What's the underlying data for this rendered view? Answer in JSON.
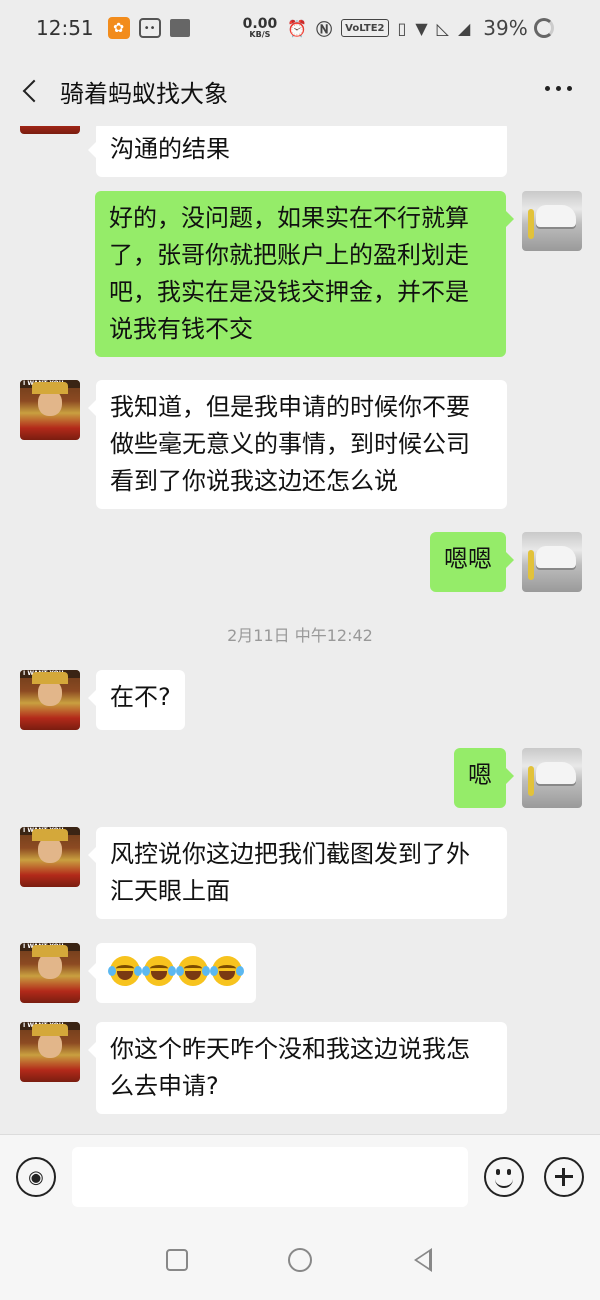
{
  "status_bar": {
    "time": "12:51",
    "net_speed_value": "0.00",
    "net_speed_unit": "KB/S",
    "volte": "VoLTE2",
    "battery": "39%"
  },
  "header": {
    "title": "骑着蚂蚁找大象"
  },
  "messages": [
    {
      "side": "in",
      "text": "沟通的结果"
    },
    {
      "side": "out",
      "text": "好的，没问题，如果实在不行就算了，张哥你就把账户上的盈利划走吧，我实在是没钱交押金，并不是说我有钱不交"
    },
    {
      "side": "in",
      "text": "我知道，但是我申请的时候你不要做些毫无意义的事情，到时候公司看到了你说我这边还怎么说"
    },
    {
      "side": "out",
      "text": "嗯嗯"
    },
    {
      "side": "in",
      "text": "在不?"
    },
    {
      "side": "out",
      "text": "嗯"
    },
    {
      "side": "in",
      "text": "风控说你这边把我们截图发到了外汇天眼上面"
    },
    {
      "side": "in",
      "text": "",
      "emoji": "laugh-cry x4"
    },
    {
      "side": "in",
      "text": "你这个昨天咋个没和我这边说我怎么去申请?"
    }
  ],
  "timestamp": "2月11日 中午12:42",
  "avatar_band_text": "I WANT YOU",
  "colors": {
    "background": "#ededed",
    "outgoing_bubble": "#95ec69",
    "incoming_bubble": "#ffffff"
  },
  "icons": {
    "back": "chevron-left-icon",
    "more": "more-dots-icon",
    "voice": "voice-icon",
    "emoji": "emoji-icon",
    "plus": "plus-icon"
  }
}
